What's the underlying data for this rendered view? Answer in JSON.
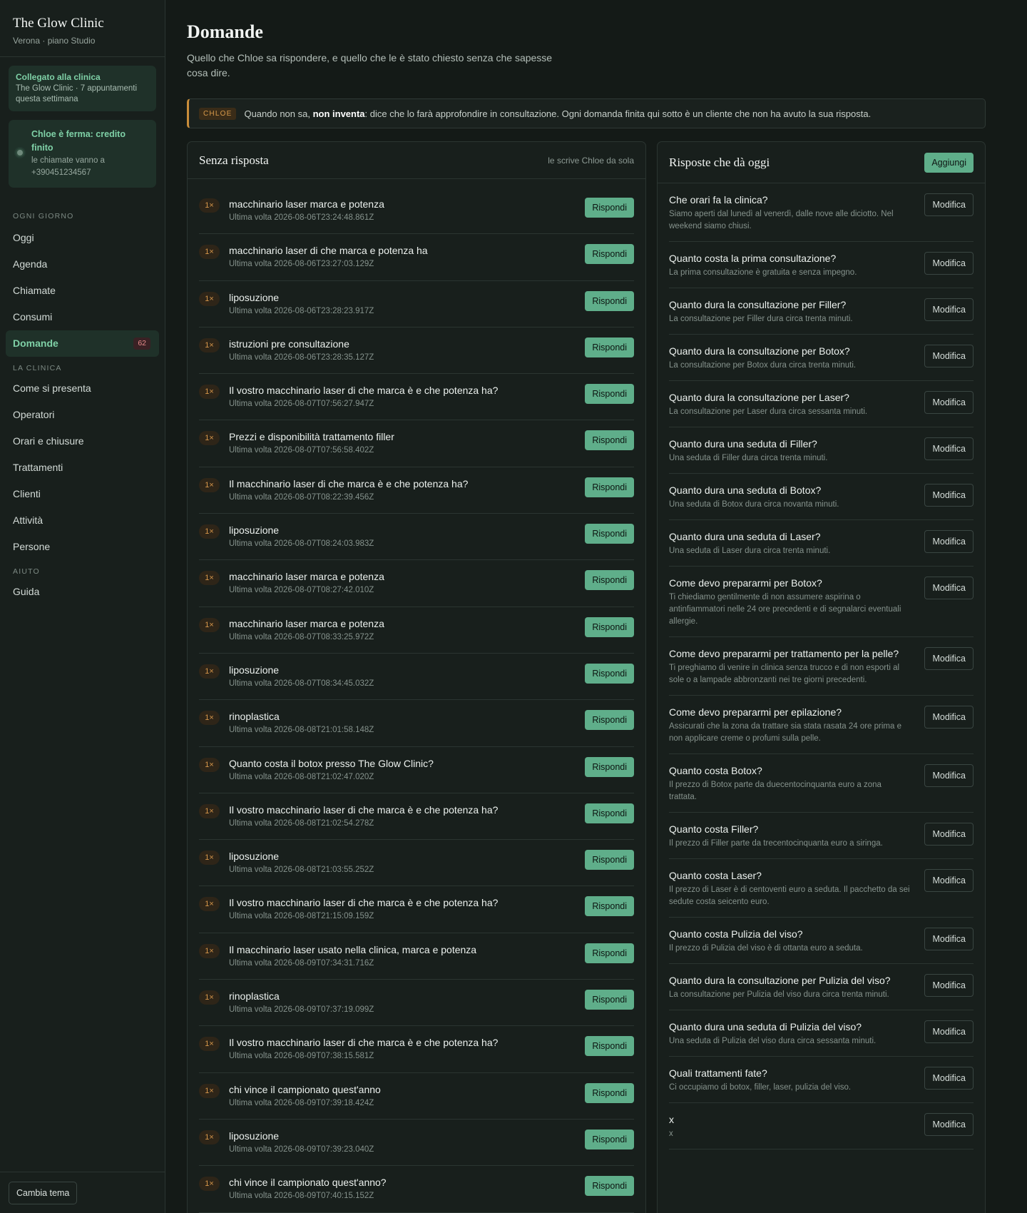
{
  "sidebar": {
    "brand_title": "The Glow Clinic",
    "brand_sub": "Verona · piano Studio",
    "connected_title": "Collegato alla clinica",
    "connected_sub": "The Glow Clinic · 7 appuntamenti questa settimana",
    "stopped_title": "Chloe è ferma: credito finito",
    "stopped_sub": "le chiamate vanno a +390451234567",
    "section_daily": "OGNI GIORNO",
    "section_clinic": "LA CLINICA",
    "section_help": "AIUTO",
    "nav_daily": [
      "Oggi",
      "Agenda",
      "Chiamate",
      "Consumi",
      "Domande"
    ],
    "domande_badge": "62",
    "nav_clinic": [
      "Come si presenta",
      "Operatori",
      "Orari e chiusure",
      "Trattamenti",
      "Clienti",
      "Attività",
      "Persone"
    ],
    "nav_help": [
      "Guida"
    ],
    "theme_button": "Cambia tema"
  },
  "header": {
    "title": "Domande",
    "description": "Quello che Chloe sa rispondere, e quello che le è stato chiesto senza che sapesse cosa dire."
  },
  "notice": {
    "tag": "CHLOE",
    "text_before": "Quando non sa, ",
    "text_bold": "non inventa",
    "text_after": ": dice che lo farà approfondire in consultazione. Ogni domanda finita qui sotto è un cliente che non ha avuto la sua risposta."
  },
  "unanswered": {
    "title": "Senza risposta",
    "note": "le scrive Chloe da sola",
    "button_label": "Rispondi",
    "items": [
      {
        "count": "1×",
        "text": "macchinario laser marca e potenza",
        "time": "Ultima volta 2026-08-06T23:24:48.861Z"
      },
      {
        "count": "1×",
        "text": "macchinario laser di che marca e potenza ha",
        "time": "Ultima volta 2026-08-06T23:27:03.129Z"
      },
      {
        "count": "1×",
        "text": "liposuzione",
        "time": "Ultima volta 2026-08-06T23:28:23.917Z"
      },
      {
        "count": "1×",
        "text": "istruzioni pre consultazione",
        "time": "Ultima volta 2026-08-06T23:28:35.127Z"
      },
      {
        "count": "1×",
        "text": "Il vostro macchinario laser di che marca è e che potenza ha?",
        "time": "Ultima volta 2026-08-07T07:56:27.947Z"
      },
      {
        "count": "1×",
        "text": "Prezzi e disponibilità trattamento filler",
        "time": "Ultima volta 2026-08-07T07:56:58.402Z"
      },
      {
        "count": "1×",
        "text": "Il macchinario laser di che marca è e che potenza ha?",
        "time": "Ultima volta 2026-08-07T08:22:39.456Z"
      },
      {
        "count": "1×",
        "text": "liposuzione",
        "time": "Ultima volta 2026-08-07T08:24:03.983Z"
      },
      {
        "count": "1×",
        "text": "macchinario laser marca e potenza",
        "time": "Ultima volta 2026-08-07T08:27:42.010Z"
      },
      {
        "count": "1×",
        "text": "macchinario laser marca e potenza",
        "time": "Ultima volta 2026-08-07T08:33:25.972Z"
      },
      {
        "count": "1×",
        "text": "liposuzione",
        "time": "Ultima volta 2026-08-07T08:34:45.032Z"
      },
      {
        "count": "1×",
        "text": "rinoplastica",
        "time": "Ultima volta 2026-08-08T21:01:58.148Z"
      },
      {
        "count": "1×",
        "text": "Quanto costa il botox presso The Glow Clinic?",
        "time": "Ultima volta 2026-08-08T21:02:47.020Z"
      },
      {
        "count": "1×",
        "text": "Il vostro macchinario laser di che marca è e che potenza ha?",
        "time": "Ultima volta 2026-08-08T21:02:54.278Z"
      },
      {
        "count": "1×",
        "text": "liposuzione",
        "time": "Ultima volta 2026-08-08T21:03:55.252Z"
      },
      {
        "count": "1×",
        "text": "Il vostro macchinario laser di che marca è e che potenza ha?",
        "time": "Ultima volta 2026-08-08T21:15:09.159Z"
      },
      {
        "count": "1×",
        "text": "Il macchinario laser usato nella clinica, marca e potenza",
        "time": "Ultima volta 2026-08-09T07:34:31.716Z"
      },
      {
        "count": "1×",
        "text": "rinoplastica",
        "time": "Ultima volta 2026-08-09T07:37:19.099Z"
      },
      {
        "count": "1×",
        "text": "Il vostro macchinario laser di che marca è e che potenza ha?",
        "time": "Ultima volta 2026-08-09T07:38:15.581Z"
      },
      {
        "count": "1×",
        "text": "chi vince il campionato quest'anno",
        "time": "Ultima volta 2026-08-09T07:39:18.424Z"
      },
      {
        "count": "1×",
        "text": "liposuzione",
        "time": "Ultima volta 2026-08-09T07:39:23.040Z"
      },
      {
        "count": "1×",
        "text": "chi vince il campionato quest'anno?",
        "time": "Ultima volta 2026-08-09T07:40:15.152Z"
      }
    ]
  },
  "answers": {
    "title": "Risposte che dà oggi",
    "add_label": "Aggiungi",
    "edit_label": "Modifica",
    "items": [
      {
        "q": "Che orari fa la clinica?",
        "a": "Siamo aperti dal lunedì al venerdì, dalle nove alle diciotto. Nel weekend siamo chiusi."
      },
      {
        "q": "Quanto costa la prima consultazione?",
        "a": "La prima consultazione è gratuita e senza impegno."
      },
      {
        "q": "Quanto dura la consultazione per Filler?",
        "a": "La consultazione per Filler dura circa trenta minuti."
      },
      {
        "q": "Quanto dura la consultazione per Botox?",
        "a": "La consultazione per Botox dura circa trenta minuti."
      },
      {
        "q": "Quanto dura la consultazione per Laser?",
        "a": "La consultazione per Laser dura circa sessanta minuti."
      },
      {
        "q": "Quanto dura una seduta di Filler?",
        "a": "Una seduta di Filler dura circa trenta minuti."
      },
      {
        "q": "Quanto dura una seduta di Botox?",
        "a": "Una seduta di Botox dura circa novanta minuti."
      },
      {
        "q": "Quanto dura una seduta di Laser?",
        "a": "Una seduta di Laser dura circa trenta minuti."
      },
      {
        "q": "Come devo prepararmi per Botox?",
        "a": "Ti chiediamo gentilmente di non assumere aspirina o antinfiammatori nelle 24 ore precedenti e di segnalarci eventuali allergie."
      },
      {
        "q": "Come devo prepararmi per trattamento per la pelle?",
        "a": "Ti preghiamo di venire in clinica senza trucco e di non esporti al sole o a lampade abbronzanti nei tre giorni precedenti."
      },
      {
        "q": "Come devo prepararmi per epilazione?",
        "a": "Assicurati che la zona da trattare sia stata rasata 24 ore prima e non applicare creme o profumi sulla pelle."
      },
      {
        "q": "Quanto costa Botox?",
        "a": "Il prezzo di Botox parte da duecentocinquanta euro a zona trattata."
      },
      {
        "q": "Quanto costa Filler?",
        "a": "Il prezzo di Filler parte da trecentocinquanta euro a siringa."
      },
      {
        "q": "Quanto costa Laser?",
        "a": "Il prezzo di Laser è di centoventi euro a seduta. Il pacchetto da sei sedute costa seicento euro."
      },
      {
        "q": "Quanto costa Pulizia del viso?",
        "a": "Il prezzo di Pulizia del viso è di ottanta euro a seduta."
      },
      {
        "q": "Quanto dura la consultazione per Pulizia del viso?",
        "a": "La consultazione per Pulizia del viso dura circa trenta minuti."
      },
      {
        "q": "Quanto dura una seduta di Pulizia del viso?",
        "a": "Una seduta di Pulizia del viso dura circa sessanta minuti."
      },
      {
        "q": "Quali trattamenti fate?",
        "a": "Ci occupiamo di botox, filler, laser, pulizia del viso."
      },
      {
        "q": "x",
        "a": "x"
      }
    ]
  }
}
